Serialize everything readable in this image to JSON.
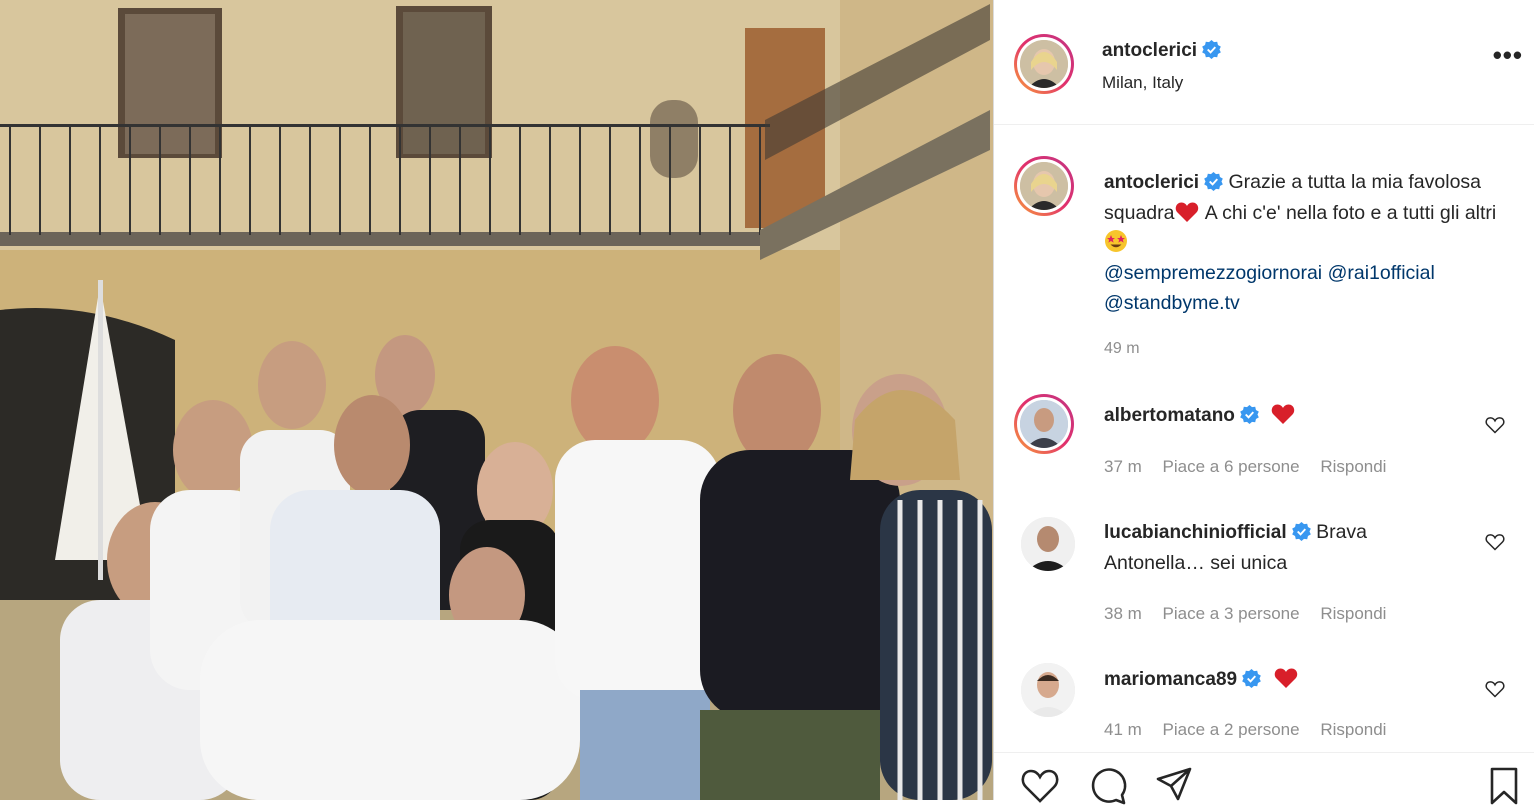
{
  "post": {
    "author": "antoclerici",
    "location": "Milan, Italy"
  },
  "caption": {
    "author": "antoclerici",
    "text_1": "Grazie a tutta la mia favolosa squadra",
    "text_2": " A chi c'e' nella foto e a tutti gli altri",
    "mention_1": "@sempremezzogiornorai",
    "mention_2": "@rai1official",
    "mention_3": "@standbyme.tv",
    "time": "49 m"
  },
  "comments": [
    {
      "user": "albertomatano",
      "text": "",
      "time": "37 m",
      "likes": "Piace a 6 persone",
      "reply": "Rispondi"
    },
    {
      "user": "lucabianchiniofficial",
      "text": "Brava Antonella… sei unica",
      "time": "38 m",
      "likes": "Piace a 3 persone",
      "reply": "Rispondi"
    },
    {
      "user": "mariomanca89",
      "text": "",
      "time": "41 m",
      "likes": "Piace a 2 persone",
      "reply": "Rispondi"
    }
  ],
  "icons": {
    "verified": "verified-badge-icon",
    "more": "more-options-icon",
    "like": "heart-icon",
    "comment": "comment-icon",
    "share": "share-icon",
    "save": "bookmark-icon"
  },
  "colors": {
    "verified": "#3897f0",
    "mention": "#00376b",
    "heart": "#ed4956",
    "muted": "#8e8e8e"
  }
}
